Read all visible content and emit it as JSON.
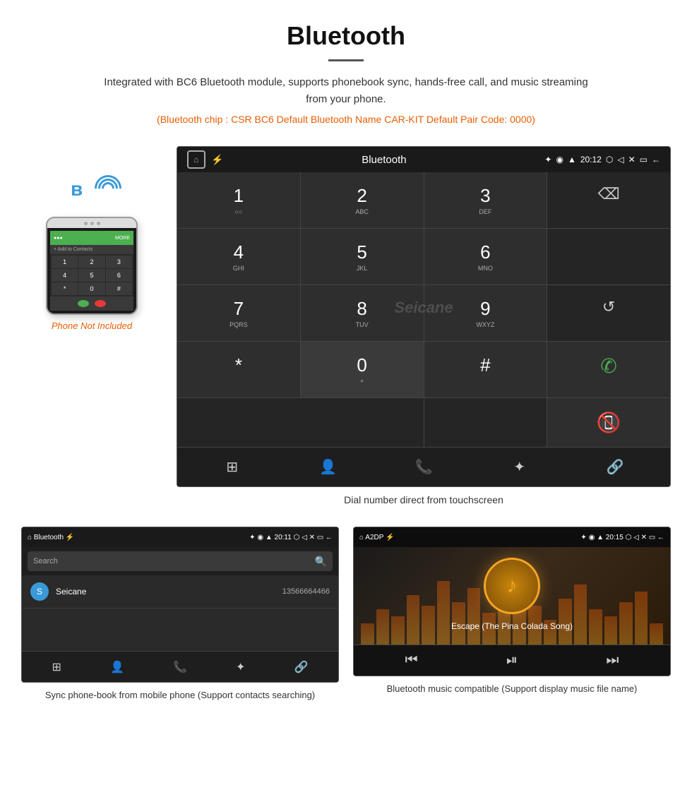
{
  "header": {
    "title": "Bluetooth",
    "description": "Integrated with BC6 Bluetooth module, supports phonebook sync, hands-free call, and music streaming from your phone.",
    "specs": "(Bluetooth chip : CSR BC6    Default Bluetooth Name CAR-KIT    Default Pair Code: 0000)"
  },
  "phone_label": "Phone Not Included",
  "dial_screen": {
    "status_bar": {
      "app_name": "Bluetooth",
      "time": "20:12"
    },
    "keys": [
      {
        "main": "1",
        "sub": "○○"
      },
      {
        "main": "2",
        "sub": "ABC"
      },
      {
        "main": "3",
        "sub": "DEF"
      },
      {
        "main": "⌫",
        "sub": ""
      },
      {
        "main": "4",
        "sub": "GHI"
      },
      {
        "main": "5",
        "sub": "JKL"
      },
      {
        "main": "6",
        "sub": "MNO"
      },
      {
        "main": "",
        "sub": ""
      },
      {
        "main": "7",
        "sub": "PQRS"
      },
      {
        "main": "8",
        "sub": "TUV"
      },
      {
        "main": "9",
        "sub": "WXYZ"
      },
      {
        "main": "↺",
        "sub": ""
      },
      {
        "main": "*",
        "sub": ""
      },
      {
        "main": "0",
        "sub": "+"
      },
      {
        "main": "#",
        "sub": ""
      },
      {
        "main": "✆",
        "sub": ""
      },
      {
        "main": "",
        "sub": ""
      },
      {
        "main": "✆end",
        "sub": ""
      }
    ],
    "caption": "Dial number direct from touchscreen"
  },
  "phonebook_screen": {
    "status_bar": {
      "app_name": "Bluetooth",
      "time": "20:11"
    },
    "search_placeholder": "Search",
    "contacts": [
      {
        "letter": "S",
        "name": "Seicane",
        "number": "13566664466"
      }
    ],
    "caption": "Sync phone-book from mobile phone\n(Support contacts searching)"
  },
  "music_screen": {
    "status_bar": {
      "app_name": "A2DP",
      "time": "20:15"
    },
    "song_title": "Escape (The Pina Colada Song)",
    "caption": "Bluetooth music compatible\n(Support display music file name)"
  },
  "watermark": "Seicane",
  "icons": {
    "home": "⌂",
    "back": "←",
    "bluetooth": "✦",
    "usb": "⚡",
    "location": "◉",
    "wifi": "▲",
    "camera": "⬡",
    "volume": "◁",
    "close_x": "✕",
    "window": "▭",
    "dialpad": "⊞",
    "person": "👤",
    "phone": "📞",
    "bt_small": "✦",
    "link": "🔗",
    "call_green": "📞",
    "call_red": "📵",
    "refresh": "↺",
    "skip_prev": "⏮",
    "play_pause": "⏯",
    "skip_next": "⏭",
    "music_note": "♪"
  }
}
